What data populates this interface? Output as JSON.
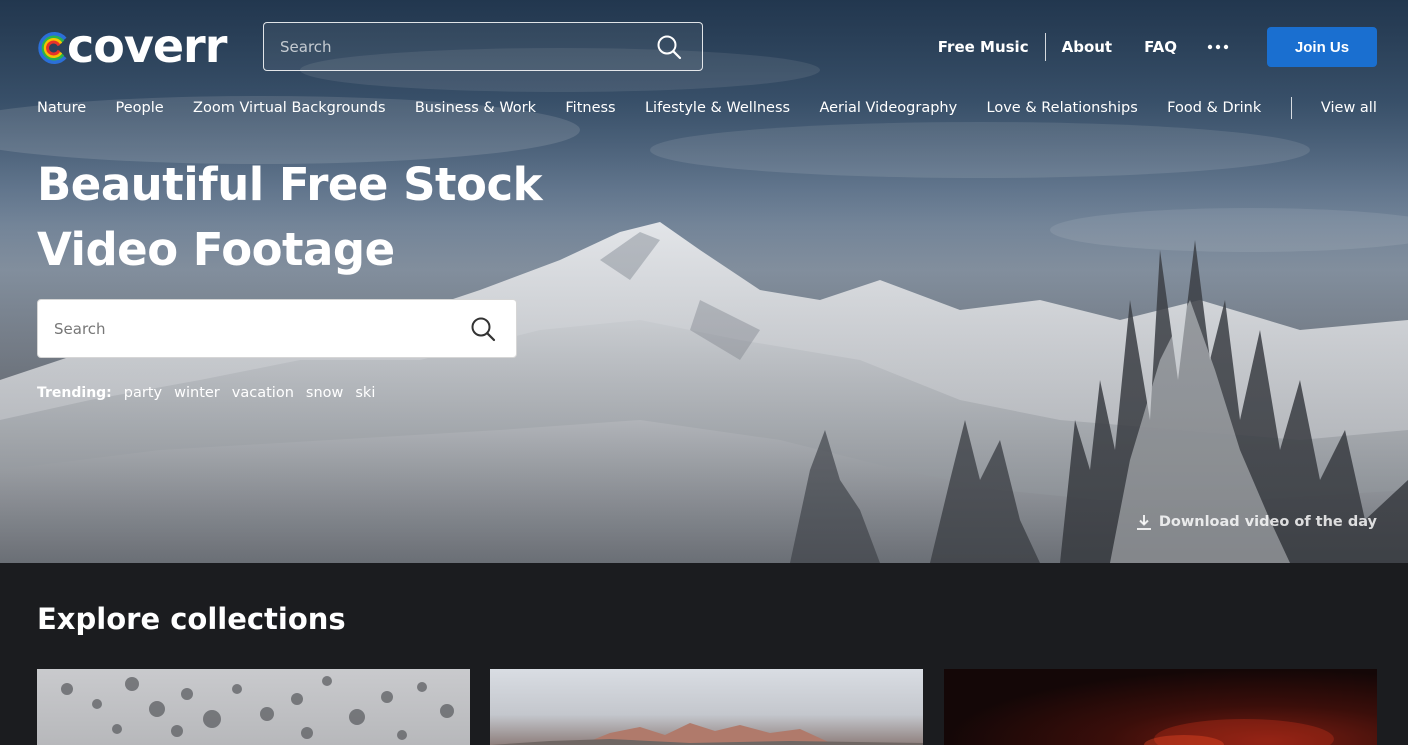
{
  "brand": {
    "name": "coverr"
  },
  "header": {
    "search_placeholder": "Search",
    "nav": {
      "free_music": "Free Music",
      "about": "About",
      "faq": "FAQ",
      "join": "Join Us"
    }
  },
  "categories": [
    "Nature",
    "People",
    "Zoom Virtual Backgrounds",
    "Business & Work",
    "Fitness",
    "Lifestyle & Wellness",
    "Aerial Videography",
    "Love & Relationships",
    "Food & Drink"
  ],
  "view_all": "View all",
  "hero": {
    "title_line1": "Beautiful Free Stock",
    "title_line2": "Video Footage",
    "search_placeholder": "Search",
    "trending_label": "Trending:",
    "trending": [
      "party",
      "winter",
      "vacation",
      "snow",
      "ski"
    ],
    "download_label": "Download video of the day"
  },
  "collections": {
    "title": "Explore collections"
  },
  "colors": {
    "accent": "#1a6fd0",
    "page_bg": "#1b1c1f"
  }
}
